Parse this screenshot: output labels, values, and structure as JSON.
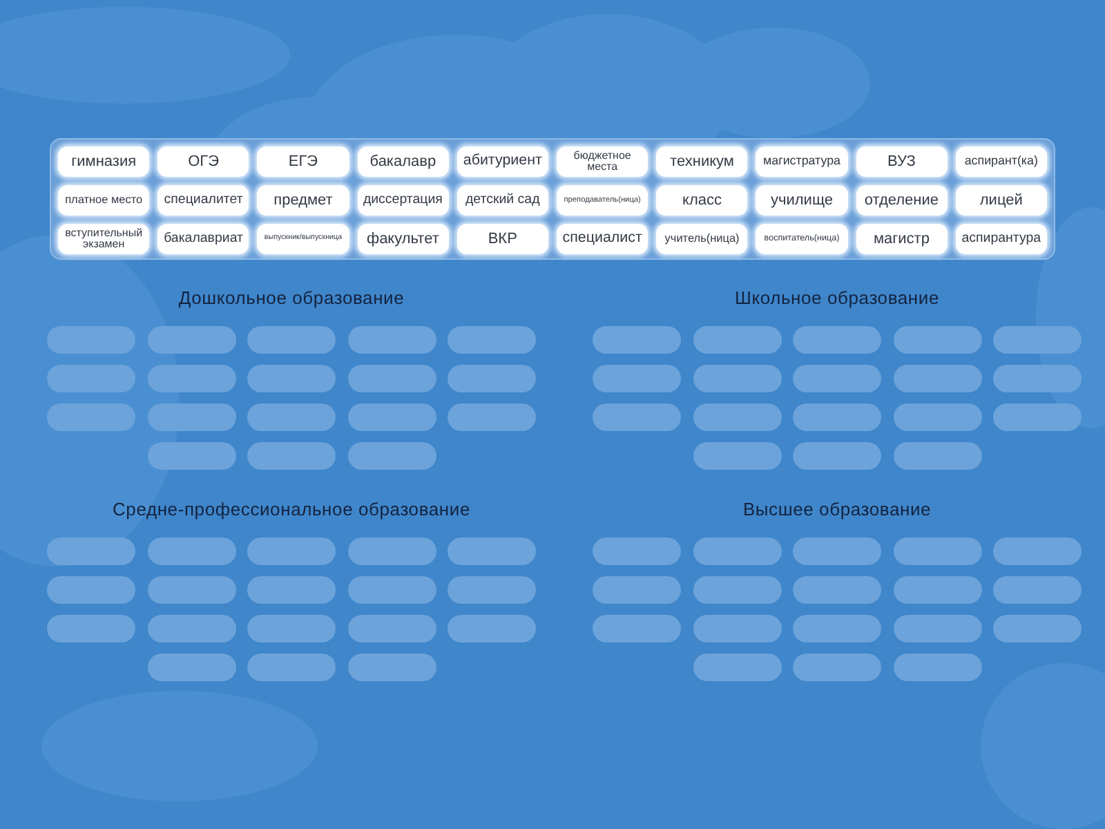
{
  "word_bank": {
    "tiles": [
      "гимназия",
      "ОГЭ",
      "ЕГЭ",
      "бакалавр",
      "абитуриент",
      "бюджетное места",
      "техникум",
      "магистратура",
      "ВУЗ",
      "аспирант(ка)",
      "платное место",
      "специалитет",
      "предмет",
      "диссертация",
      "детский сад",
      "преподаватель(ница)",
      "класс",
      "училище",
      "отделение",
      "лицей",
      "вступительный экзамен",
      "бакалавриат",
      "выпускник/выпускница",
      "факультет",
      "ВКР",
      "специалист",
      "учитель(ница)",
      "воспитатель(ница)",
      "магистр",
      "аспирантура"
    ]
  },
  "groups": [
    {
      "title": "Дошкольное образование"
    },
    {
      "title": "Школьное образование"
    },
    {
      "title": "Средне-профессиональное образование"
    },
    {
      "title": "Высшее образование"
    }
  ]
}
